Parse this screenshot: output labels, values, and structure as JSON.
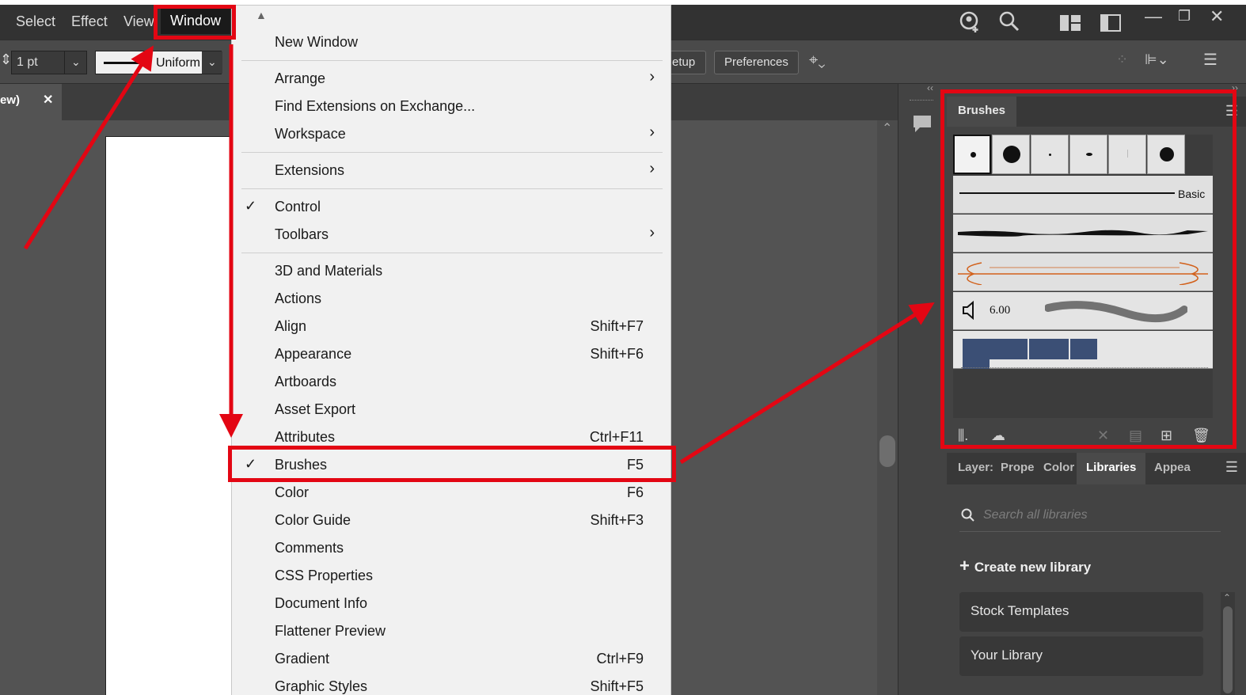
{
  "menubar": {
    "items": [
      "Select",
      "Effect",
      "View",
      "Window"
    ]
  },
  "control": {
    "stroke_weight": "1 pt",
    "profile": "Uniform",
    "setup_label": "etup",
    "preferences_label": "Preferences"
  },
  "document_tab": {
    "title": "ew)",
    "close": "✕"
  },
  "window_menu": {
    "sections": [
      [
        {
          "label": "New Window"
        }
      ],
      [
        {
          "label": "Arrange",
          "submenu": true
        },
        {
          "label": "Find Extensions on Exchange..."
        },
        {
          "label": "Workspace",
          "submenu": true
        }
      ],
      [
        {
          "label": "Extensions",
          "submenu": true
        }
      ],
      [
        {
          "label": "Control",
          "checked": true
        },
        {
          "label": "Toolbars",
          "submenu": true
        }
      ],
      [
        {
          "label": "3D and Materials"
        },
        {
          "label": "Actions"
        },
        {
          "label": "Align",
          "shortcut": "Shift+F7"
        },
        {
          "label": "Appearance",
          "shortcut": "Shift+F6"
        },
        {
          "label": "Artboards"
        },
        {
          "label": "Asset Export"
        },
        {
          "label": "Attributes",
          "shortcut": "Ctrl+F11"
        },
        {
          "label": "Brushes",
          "shortcut": "F5",
          "checked": true
        },
        {
          "label": "Color",
          "shortcut": "F6"
        },
        {
          "label": "Color Guide",
          "shortcut": "Shift+F3"
        },
        {
          "label": "Comments"
        },
        {
          "label": "CSS Properties"
        },
        {
          "label": "Document Info"
        },
        {
          "label": "Flattener Preview"
        },
        {
          "label": "Gradient",
          "shortcut": "Ctrl+F9"
        },
        {
          "label": "Graphic Styles",
          "shortcut": "Shift+F5"
        }
      ]
    ]
  },
  "brushes_panel": {
    "tab": "Brushes",
    "basic_label": "Basic",
    "size_value": "6.00"
  },
  "libraries_panel": {
    "tabs": [
      "Layer:",
      "Prope",
      "Color",
      "Libraries",
      "Appea"
    ],
    "search_placeholder": "Search all libraries",
    "create_label": "Create new library",
    "libraries": [
      "Stock Templates",
      "Your Library"
    ]
  },
  "colors": {
    "annotation_red": "#e30613",
    "brush_orange": "#d2601a"
  }
}
